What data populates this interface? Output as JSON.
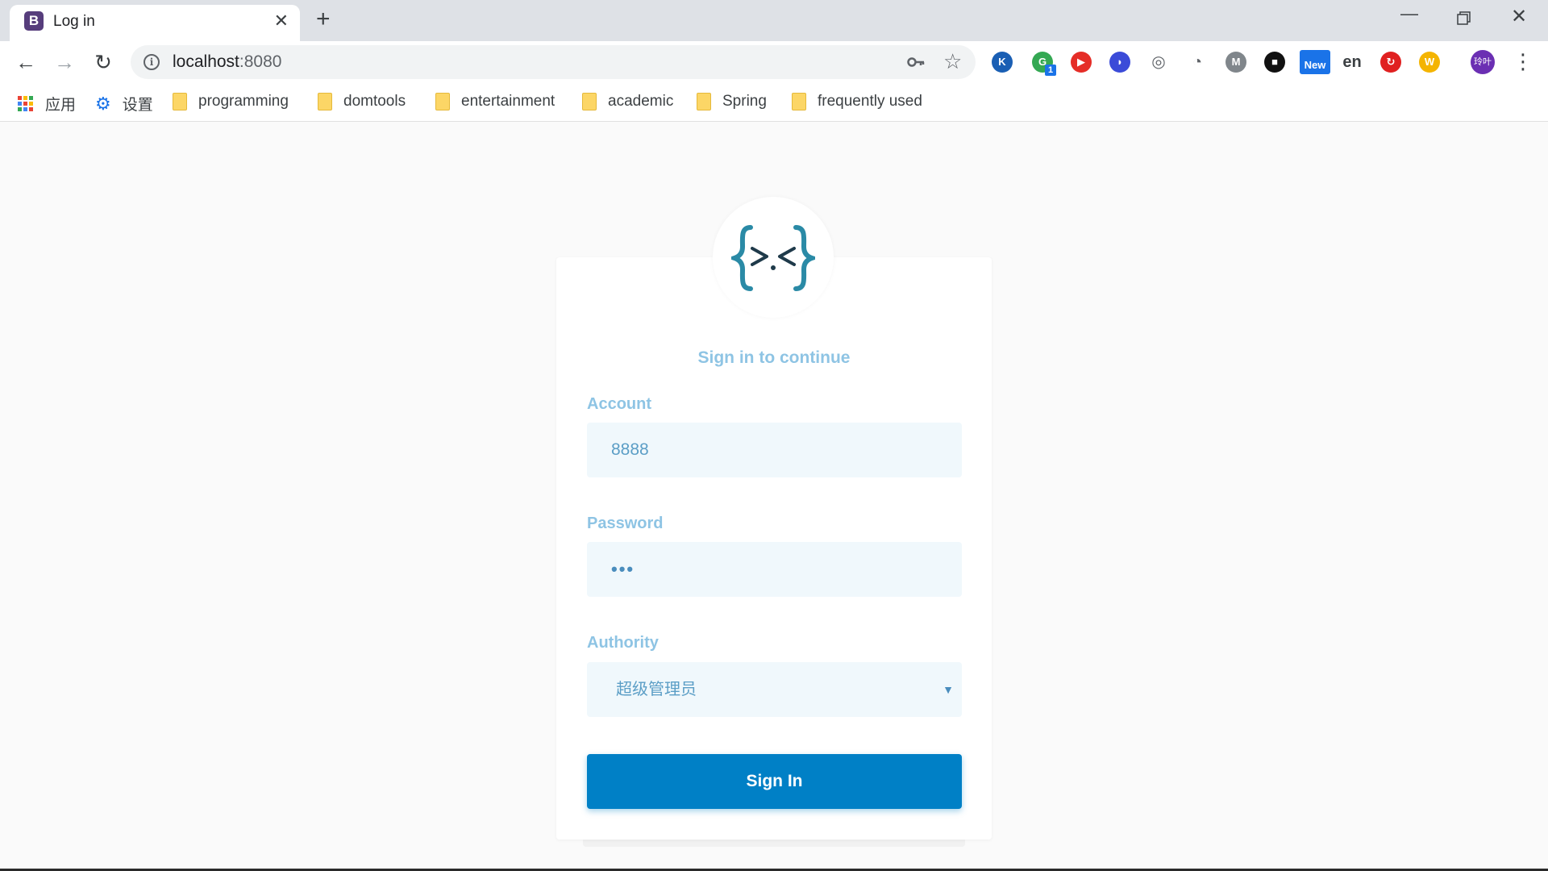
{
  "browser": {
    "tab": {
      "favicon_letter": "B",
      "title": "Log in",
      "close_glyph": "✕"
    },
    "new_tab_glyph": "+",
    "window_controls": {
      "minimize": "—",
      "restore": "❐",
      "close": "✕"
    },
    "nav": {
      "back": "←",
      "forward": "→",
      "reload": "↻"
    },
    "address": {
      "host": "localhost",
      "port": ":8080"
    },
    "extensions": [
      {
        "icon": "k-icon",
        "glyph": "K",
        "color": "#1a5fb4"
      },
      {
        "icon": "translate-icon",
        "glyph": "G",
        "color": "#34a853",
        "badge": "1"
      },
      {
        "icon": "youtube-icon",
        "glyph": "▶",
        "color": "#e52d27"
      },
      {
        "icon": "moon-icon",
        "glyph": "◗",
        "color": "#3b4bd8"
      },
      {
        "icon": "spiral-icon",
        "glyph": "◎",
        "color": "#5f6368"
      },
      {
        "icon": "speed-icon",
        "glyph": "◔",
        "color": "#5f6368"
      },
      {
        "icon": "m-icon",
        "glyph": "M",
        "color": "#80868b"
      },
      {
        "icon": "square-icon",
        "glyph": "■",
        "color": "#111111"
      },
      {
        "icon": "new-icon",
        "glyph": "New",
        "color": "#1a73e8"
      },
      {
        "icon": "dict-icon",
        "glyph": "en",
        "color": "#3c4043"
      },
      {
        "icon": "red-circle-icon",
        "glyph": "↻",
        "color": "#e02020"
      },
      {
        "icon": "w-icon",
        "glyph": "W",
        "color": "#f4b400"
      }
    ],
    "avatar": "玲叶",
    "menu_glyph": "⋮"
  },
  "bookmarks": {
    "apps": "应用",
    "settings": "设置",
    "folders": [
      "programming",
      "domtools",
      "entertainment",
      "academic",
      "Spring",
      "frequently used"
    ]
  },
  "login": {
    "subtitle": "Sign in to continue",
    "account_label": "Account",
    "account_value": "8888",
    "password_label": "Password",
    "password_value": "•••",
    "authority_label": "Authority",
    "authority_value": "超级管理员",
    "submit_label": "Sign In"
  },
  "colors": {
    "accent": "#0080c6",
    "label": "#8ec4e4",
    "field_bg": "#f0f8fc",
    "logo": "#2a8aa6"
  }
}
